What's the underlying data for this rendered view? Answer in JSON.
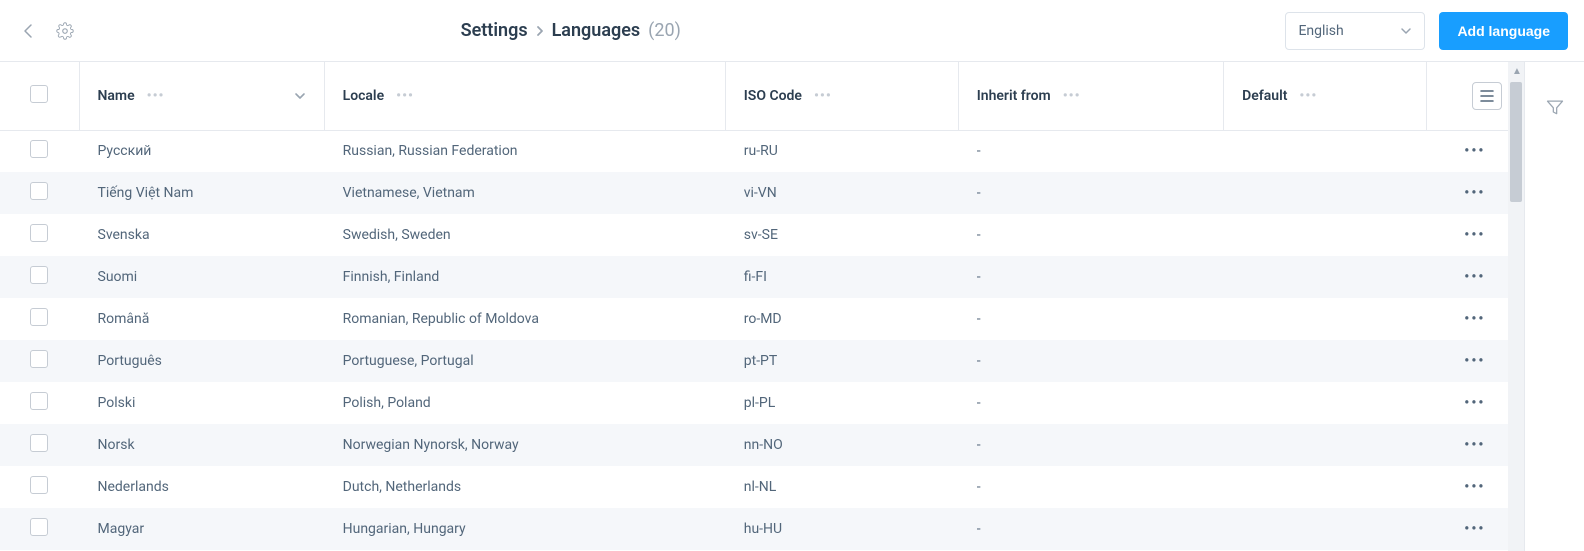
{
  "header": {
    "breadcrumb_root": "Settings",
    "breadcrumb_current": "Languages",
    "count_display": "(20)",
    "language_selector_value": "English",
    "add_button_label": "Add language"
  },
  "columns": {
    "name": "Name",
    "locale": "Locale",
    "iso": "ISO Code",
    "inherit": "Inherit from",
    "default": "Default"
  },
  "rows": [
    {
      "name": "Русский",
      "locale": "Russian, Russian Federation",
      "iso": "ru-RU",
      "inherit": "-",
      "default": ""
    },
    {
      "name": "Tiếng Việt Nam",
      "locale": "Vietnamese, Vietnam",
      "iso": "vi-VN",
      "inherit": "-",
      "default": ""
    },
    {
      "name": "Svenska",
      "locale": "Swedish, Sweden",
      "iso": "sv-SE",
      "inherit": "-",
      "default": ""
    },
    {
      "name": "Suomi",
      "locale": "Finnish, Finland",
      "iso": "fi-FI",
      "inherit": "-",
      "default": ""
    },
    {
      "name": "Română",
      "locale": "Romanian, Republic of Moldova",
      "iso": "ro-MD",
      "inherit": "-",
      "default": ""
    },
    {
      "name": "Português",
      "locale": "Portuguese, Portugal",
      "iso": "pt-PT",
      "inherit": "-",
      "default": ""
    },
    {
      "name": "Polski",
      "locale": "Polish, Poland",
      "iso": "pl-PL",
      "inherit": "-",
      "default": ""
    },
    {
      "name": "Norsk",
      "locale": "Norwegian Nynorsk, Norway",
      "iso": "nn-NO",
      "inherit": "-",
      "default": ""
    },
    {
      "name": "Nederlands",
      "locale": "Dutch, Netherlands",
      "iso": "nl-NL",
      "inherit": "-",
      "default": ""
    },
    {
      "name": "Magyar",
      "locale": "Hungarian, Hungary",
      "iso": "hu-HU",
      "inherit": "-",
      "default": ""
    }
  ]
}
